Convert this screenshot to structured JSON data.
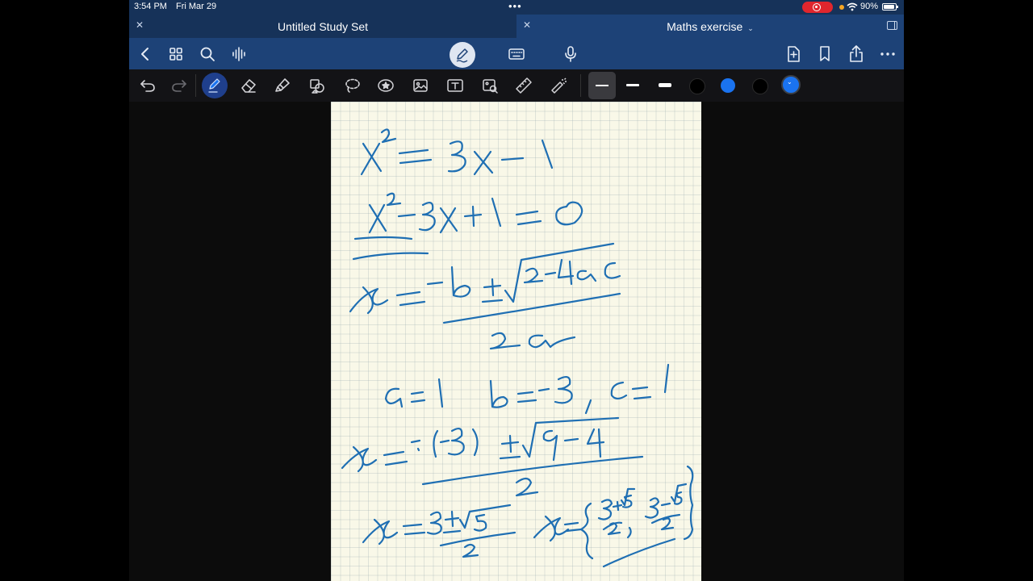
{
  "status_bar": {
    "time": "3:54 PM",
    "date": "Fri Mar 29",
    "battery": "90%"
  },
  "tabs": [
    {
      "label": "Untitled Study Set",
      "active": false
    },
    {
      "label": "Maths exercise",
      "active": true
    }
  ],
  "nav_icons": [
    "back-icon",
    "grid-icon",
    "search-icon",
    "audio-icon",
    "pen-mode-icon",
    "keyboard-icon",
    "microphone-icon",
    "add-page-icon",
    "bookmark-icon",
    "share-icon",
    "more-icon"
  ],
  "tools": [
    "undo",
    "redo",
    "pen",
    "eraser",
    "highlighter",
    "shapes",
    "lasso",
    "stickers",
    "image",
    "text",
    "camera-image",
    "ruler",
    "laser-pointer"
  ],
  "colors": {
    "ink": "#1f6fb3",
    "palette": [
      "#000000",
      "#1a73f0",
      "#000000"
    ],
    "selected": "#1a73f0",
    "header": "#163259",
    "toolbar": "#1d4277"
  },
  "note_lines": [
    "x² = 3x − 1",
    "x² − 3x + 1 = 0",
    "x = −b ± √(b²−4ac) / 2a",
    "a = 1   b = −3 ,  c = 1",
    "x = −(−3) ± √(9−4) / 2",
    "x = (3 ± √5)/2     x = { (3+√5)/2 , (3−√5)/2 }"
  ]
}
